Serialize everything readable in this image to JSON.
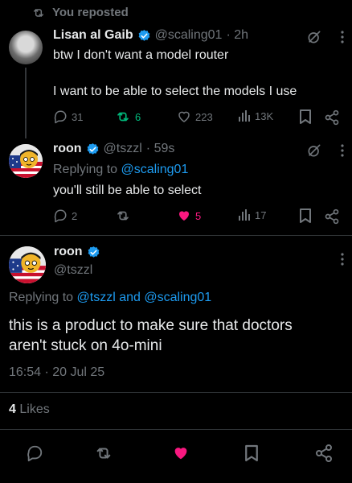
{
  "repost_banner": {
    "text": "You reposted"
  },
  "tweet1": {
    "name": "Lisan al Gaib",
    "handle": "@scaling01",
    "time": "· 2h",
    "line1": "btw I don't want a model router",
    "line2": "I want to be able to select the models I use",
    "replies": "31",
    "reposts": "6",
    "likes": "223",
    "views": "13K"
  },
  "tweet2": {
    "name": "roon",
    "handle": "@tszzl",
    "time": "· 59s",
    "replying_prefix": "Replying to",
    "replying_to": "@scaling01",
    "text": "you'll still be able to select",
    "replies": "2",
    "reposts": "",
    "likes": "5",
    "views": "17"
  },
  "main_tweet": {
    "name": "roon",
    "handle": "@tszzl",
    "replying_prefix": "Replying to",
    "replying_users": "@tszzl and @scaling01",
    "line1": "this is a product to make sure that doctors",
    "line2": "aren't stuck on 4o-mini",
    "timestamp": "16:54 · 20 Jul 25",
    "likes_count": "4",
    "likes_label": "Likes"
  },
  "colors": {
    "accent": "#1d9bf0",
    "repost_green": "#00ba7c",
    "like_pink": "#f91880",
    "muted": "#71767b"
  },
  "icons": [
    "repost-icon",
    "verified-badge-icon",
    "grok-icon",
    "more-icon",
    "reply-icon",
    "like-icon",
    "views-icon",
    "bookmark-icon",
    "share-icon"
  ]
}
